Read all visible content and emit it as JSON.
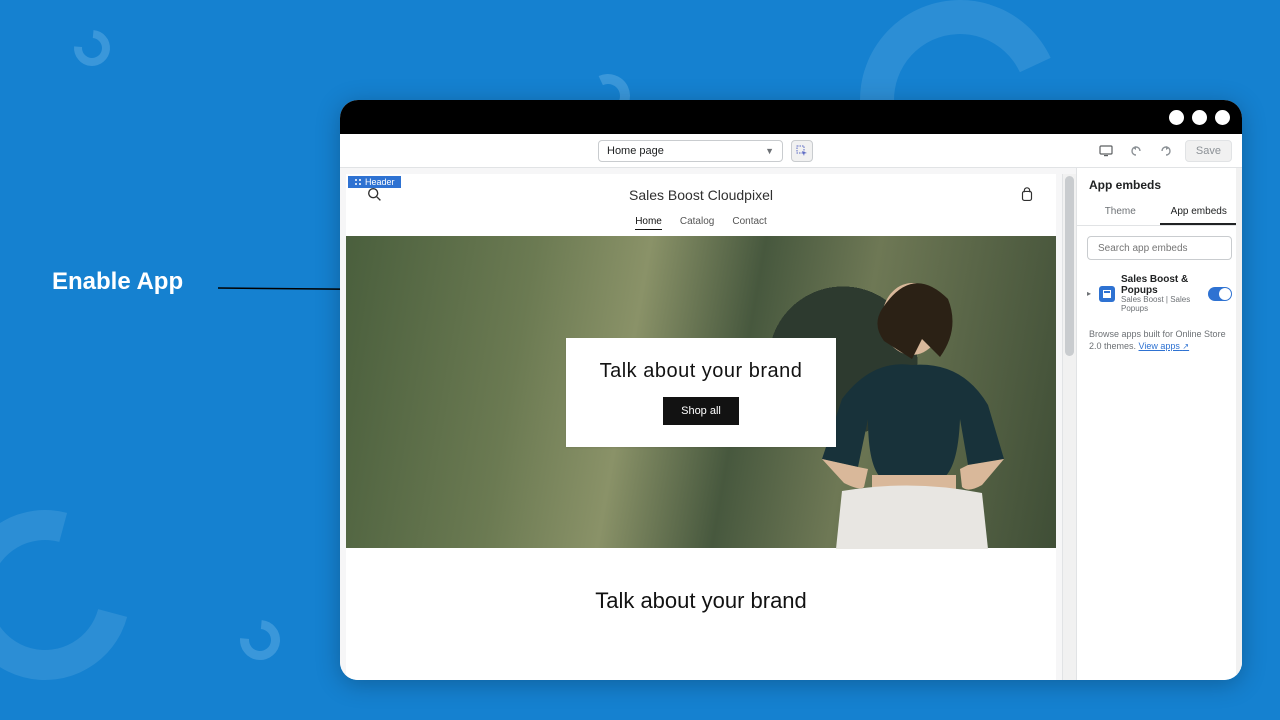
{
  "annotation": {
    "label": "Enable App"
  },
  "toolbar": {
    "page_selector_value": "Home page",
    "save_label": "Save"
  },
  "preview": {
    "section_chip": "Header",
    "store_name": "Sales Boost Cloudpixel",
    "nav": {
      "home": "Home",
      "catalog": "Catalog",
      "contact": "Contact"
    },
    "hero_heading": "Talk about your brand",
    "hero_button": "Shop all",
    "section2_heading": "Talk about your brand"
  },
  "sidepanel": {
    "title": "App embeds",
    "tabs": {
      "settings": "Theme",
      "embeds": "App embeds"
    },
    "search_placeholder": "Search app embeds",
    "embed": {
      "title": "Sales Boost & Popups",
      "subtitle": "Sales Boost | Sales Popups"
    },
    "help_text_prefix": "Browse apps built for Online Store 2.0 themes. ",
    "help_link_text": "View apps"
  }
}
